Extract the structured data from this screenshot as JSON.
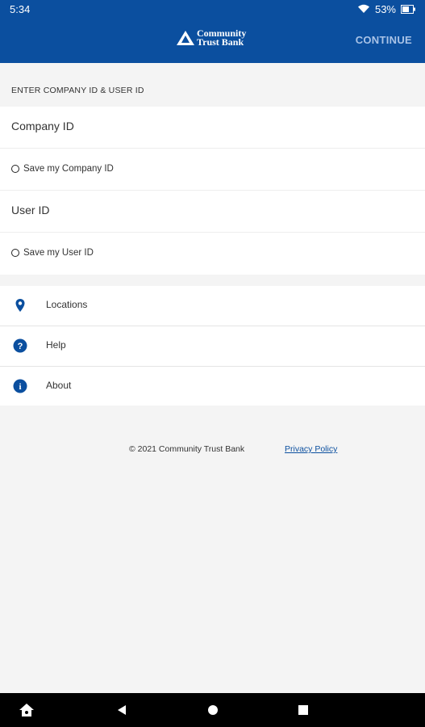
{
  "status": {
    "time": "5:34",
    "battery": "53%"
  },
  "appbar": {
    "logo_line1": "Community",
    "logo_line2": "Trust Bank",
    "continue_label": "CONTINUE"
  },
  "form": {
    "section_label": "ENTER COMPANY ID & USER ID",
    "company_id_placeholder": "Company ID",
    "save_company_label": "Save my Company ID",
    "user_id_placeholder": "User ID",
    "save_user_label": "Save my User ID"
  },
  "menu": {
    "items": [
      {
        "label": "Locations",
        "icon": "location-pin-icon"
      },
      {
        "label": "Help",
        "icon": "help-icon"
      },
      {
        "label": "About",
        "icon": "info-icon"
      }
    ]
  },
  "footer": {
    "copyright": "© 2021 Community Trust Bank",
    "privacy_link": "Privacy Policy"
  },
  "colors": {
    "brand": "#0b4f9f",
    "continue_text": "#a9c3e7"
  }
}
